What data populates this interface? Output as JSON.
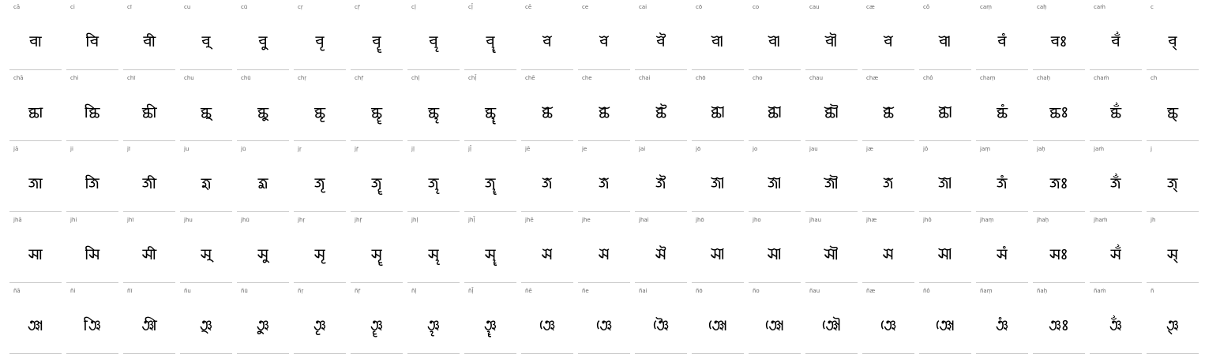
{
  "rows": [
    {
      "labels": [
        "cā",
        "ci",
        "cī",
        "cu",
        "cū",
        "cṛ",
        "cṝ",
        "cḷ",
        "cḹ",
        "cē",
        "ce",
        "cai",
        "cō",
        "co",
        "cau",
        "cæ",
        "cô",
        "caṃ",
        "caḥ",
        "caṁ",
        "c"
      ],
      "glyphs": [
        "𑐔𑐵",
        "𑐔𑐶",
        "𑐔𑐷",
        "𑐔𑐸",
        "𑐔𑐹",
        "𑐔𑐺",
        "𑐔𑐻",
        "𑐔𑐼",
        "𑐔𑐽",
        "𑐔𑐾",
        "𑐔𑐾",
        "𑐔𑐿",
        "𑐔𑑀",
        "𑐔𑑀",
        "𑐔𑑁",
        "𑐔𑐾",
        "𑐔𑑀",
        "𑐔𑑄",
        "𑐔𑑅",
        "𑐔𑑃",
        "𑐔𑑂"
      ]
    },
    {
      "labels": [
        "chā",
        "chi",
        "chī",
        "chu",
        "chū",
        "chṛ",
        "chṝ",
        "chḷ",
        "chḹ",
        "chē",
        "che",
        "chai",
        "chō",
        "cho",
        "chau",
        "chæ",
        "chô",
        "chaṃ",
        "chaḥ",
        "chaṁ",
        "ch"
      ],
      "glyphs": [
        "𑐕𑐵",
        "𑐕𑐶",
        "𑐕𑐷",
        "𑐕𑐸",
        "𑐕𑐹",
        "𑐕𑐺",
        "𑐕𑐻",
        "𑐕𑐼",
        "𑐕𑐽",
        "𑐕𑐾",
        "𑐕𑐾",
        "𑐕𑐿",
        "𑐕𑑀",
        "𑐕𑑀",
        "𑐕𑑁",
        "𑐕𑐾",
        "𑐕𑑀",
        "𑐕𑑄",
        "𑐕𑑅",
        "𑐕𑑃",
        "𑐕𑑂"
      ]
    },
    {
      "labels": [
        "jā",
        "ji",
        "jī",
        "ju",
        "jū",
        "jṛ",
        "jṝ",
        "jḷ",
        "jḹ",
        "jē",
        "je",
        "jai",
        "jō",
        "jo",
        "jau",
        "jæ",
        "jô",
        "jaṃ",
        "jaḥ",
        "jaṁ",
        "j"
      ],
      "glyphs": [
        "𑐖𑐵",
        "𑐖𑐶",
        "𑐖𑐷",
        "𑐖𑐸",
        "𑐖𑐹",
        "𑐖𑐺",
        "𑐖𑐻",
        "𑐖𑐼",
        "𑐖𑐽",
        "𑐖𑐾",
        "𑐖𑐾",
        "𑐖𑐿",
        "𑐖𑑀",
        "𑐖𑑀",
        "𑐖𑑁",
        "𑐖𑐾",
        "𑐖𑑀",
        "𑐖𑑄",
        "𑐖𑑅",
        "𑐖𑑃",
        "𑐖𑑂"
      ]
    },
    {
      "labels": [
        "jhā",
        "jhi",
        "jhī",
        "jhu",
        "jhū",
        "jhṛ",
        "jhṝ",
        "jhḷ",
        "jhḹ",
        "jhē",
        "jhe",
        "jhai",
        "jhō",
        "jho",
        "jhau",
        "jhæ",
        "jhô",
        "jhaṃ",
        "jhaḥ",
        "jhaṁ",
        "jh"
      ],
      "glyphs": [
        "𑐗𑐵",
        "𑐗𑐶",
        "𑐗𑐷",
        "𑐗𑐸",
        "𑐗𑐹",
        "𑐗𑐺",
        "𑐗𑐻",
        "𑐗𑐼",
        "𑐗𑐽",
        "𑐗𑐾",
        "𑐗𑐾",
        "𑐗𑐿",
        "𑐗𑑀",
        "𑐗𑑀",
        "𑐗𑑁",
        "𑐗𑐾",
        "𑐗𑑀",
        "𑐗𑑄",
        "𑐗𑑅",
        "𑐗𑑃",
        "𑐗𑑂"
      ]
    },
    {
      "labels": [
        "ñā",
        "ñi",
        "ñī",
        "ñu",
        "ñū",
        "ñṛ",
        "ñṝ",
        "ñḷ",
        "ñḹ",
        "ñē",
        "ñe",
        "ñai",
        "ñō",
        "ño",
        "ñau",
        "ñæ",
        "ñô",
        "ñaṃ",
        "ñaḥ",
        "ñaṁ",
        "ñ"
      ],
      "glyphs": [
        "𑐘𑐵",
        "𑐘𑐶",
        "𑐘𑐷",
        "𑐘𑐸",
        "𑐘𑐹",
        "𑐘𑐺",
        "𑐘𑐻",
        "𑐘𑐼",
        "𑐘𑐽",
        "𑐘𑐾",
        "𑐘𑐾",
        "𑐘𑐿",
        "𑐘𑑀",
        "𑐘𑑀",
        "𑐘𑑁",
        "𑐘𑐾",
        "𑐘𑑀",
        "𑐘𑑄",
        "𑐘𑑅",
        "𑐘𑑃",
        "𑐘𑑂"
      ]
    }
  ]
}
